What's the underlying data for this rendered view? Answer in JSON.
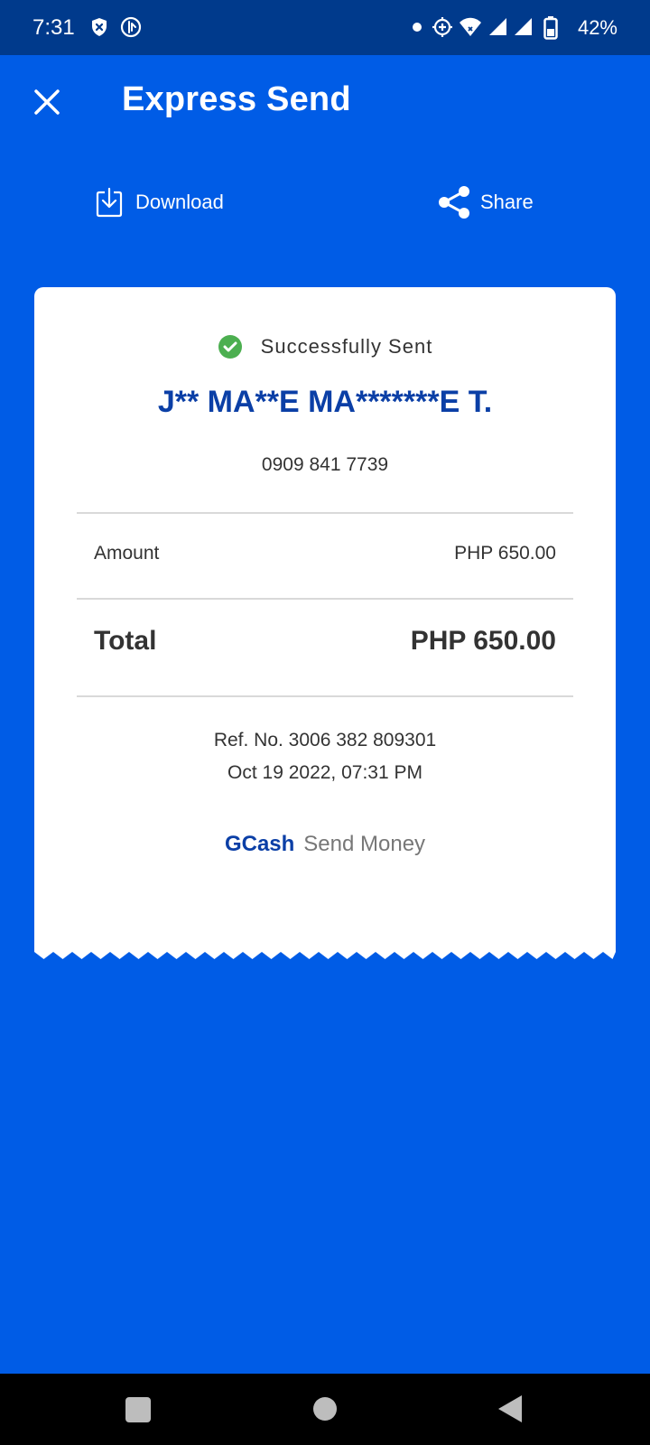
{
  "status_bar": {
    "time": "7:31",
    "battery_percent": "42%",
    "left_icons": [
      "shield-x-icon",
      "data-saver-icon"
    ],
    "right_icons": [
      "notification-dot-icon",
      "location-target-icon",
      "wifi-icon",
      "signal-icon",
      "signal-icon",
      "battery-icon"
    ]
  },
  "header": {
    "title": "Express Send",
    "close_icon": "close-icon"
  },
  "actions": {
    "download_label": "Download",
    "share_label": "Share"
  },
  "receipt": {
    "status_text": "Successfully Sent",
    "recipient_name": "J** MA**E MA*******E T.",
    "recipient_phone": "0909 841 7739",
    "amount_label": "Amount",
    "amount_value": "PHP 650.00",
    "total_label": "Total",
    "total_value": "PHP 650.00",
    "reference": "Ref. No. 3006 382 809301",
    "timestamp": "Oct 19 2022, 07:31 PM",
    "brand_name": "GCash",
    "brand_product": "Send Money"
  },
  "colors": {
    "background": "#005ce6",
    "status_bar": "#003a8c",
    "accent_text": "#0b3fa6",
    "success": "#4caf50"
  },
  "nav": {
    "buttons": [
      "recents-icon",
      "home-icon",
      "back-icon"
    ]
  }
}
